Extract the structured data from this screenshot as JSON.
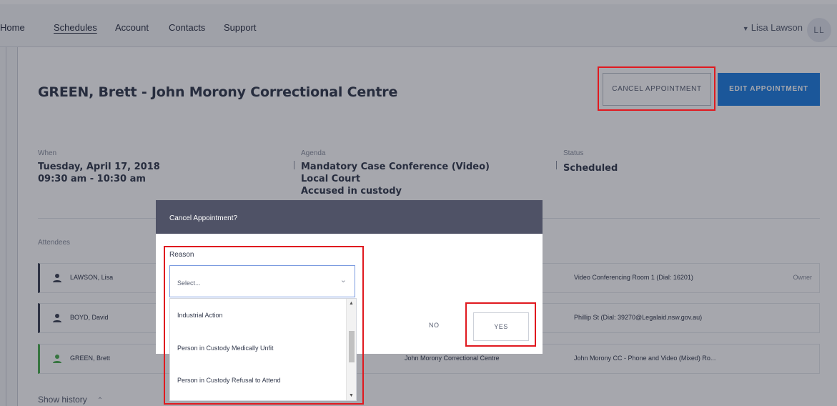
{
  "nav": {
    "links": [
      "Home",
      "Schedules",
      "Account",
      "Contacts",
      "Support"
    ],
    "user_name": "Lisa Lawson",
    "avatar_initials": "LL"
  },
  "appointment": {
    "title": "GREEN, Brett - John Morony Correctional Centre",
    "cancel_label": "CANCEL APPOINTMENT",
    "edit_label": "EDIT APPOINTMENT",
    "when_label": "When",
    "when_date": "Tuesday, April 17, 2018",
    "when_time": "09:30 am - 10:30 am",
    "agenda_label": "Agenda",
    "agenda_lines": [
      "Mandatory Case Conference (Video)",
      "Local Court",
      "Accused in custody"
    ],
    "status_label": "Status",
    "status_value": "Scheduled"
  },
  "attendees": {
    "label": "Attendees",
    "rows": [
      {
        "name": "LAWSON, Lisa",
        "location": "",
        "room": "Video Conferencing Room 1 (Dial: 16201)",
        "role": "Owner"
      },
      {
        "name": "BOYD, David",
        "location": "",
        "room": "Phillip St (Dial: 39270@Legalaid.nsw.gov.au)",
        "role": ""
      },
      {
        "name": "GREEN, Brett",
        "location": "John Morony Correctional Centre",
        "room": "John Morony CC - Phone and Video (Mixed) Ro...",
        "role": ""
      }
    ],
    "show_history": "Show history"
  },
  "modal": {
    "title": "Cancel Appointment?",
    "reason_label": "Reason",
    "select_placeholder": "Select...",
    "options": [
      "Industrial Action",
      "Person in Custody Medically Unfit",
      "Person in Custody Refusal to Attend"
    ],
    "no_label": "NO",
    "yes_label": "YES"
  },
  "colors": {
    "accent": "#1f7ee0",
    "highlight": "#e0191f",
    "modal_header": "#4f5266",
    "custody_green": "#4caf50"
  }
}
